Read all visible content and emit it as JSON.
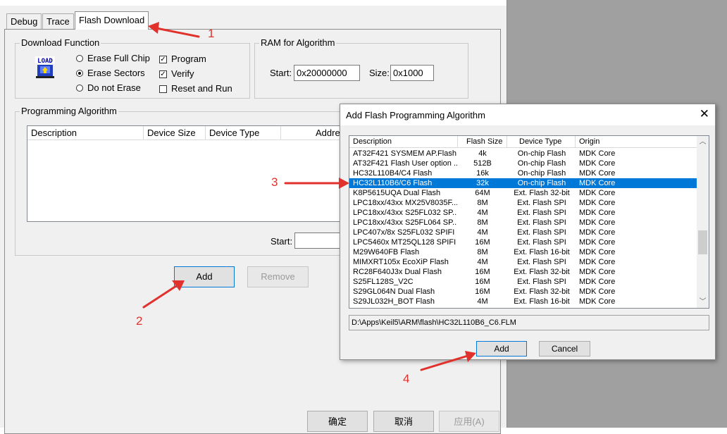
{
  "tabs": [
    {
      "label": "Debug"
    },
    {
      "label": "Trace"
    },
    {
      "label": "Flash Download"
    }
  ],
  "download_function": {
    "title": "Download Function",
    "icon": "load-icon",
    "icon_text": "LOAD",
    "radios": [
      {
        "label": "Erase Full Chip",
        "selected": false
      },
      {
        "label": "Erase Sectors",
        "selected": true
      },
      {
        "label": "Do not Erase",
        "selected": false
      }
    ],
    "checks": [
      {
        "label": "Program",
        "checked": true
      },
      {
        "label": "Verify",
        "checked": true
      },
      {
        "label": "Reset and Run",
        "checked": false
      }
    ]
  },
  "ram_algorithm": {
    "title": "RAM for Algorithm",
    "start_label": "Start:",
    "start_value": "0x20000000",
    "size_label": "Size:",
    "size_value": "0x1000"
  },
  "programming_algorithm": {
    "title": "Programming Algorithm",
    "columns": [
      "Description",
      "Device Size",
      "Device Type",
      "Address Range"
    ],
    "start_label": "Start:",
    "add_button": "Add",
    "remove_button": "Remove"
  },
  "footer": {
    "ok": "确定",
    "cancel": "取消",
    "apply": "应用(A)"
  },
  "add_dialog": {
    "title": "Add Flash Programming Algorithm",
    "columns": [
      "Description",
      "Flash Size",
      "Device Type",
      "Origin"
    ],
    "rows": [
      {
        "description": "AT32F421 SYSMEM AP.Flash",
        "size": "4k",
        "type": "On-chip Flash",
        "origin": "MDK Core",
        "selected": false
      },
      {
        "description": "AT32F421 Flash User option ...",
        "size": "512B",
        "type": "On-chip Flash",
        "origin": "MDK Core",
        "selected": false
      },
      {
        "description": "HC32L110B4/C4 Flash",
        "size": "16k",
        "type": "On-chip Flash",
        "origin": "MDK Core",
        "selected": false
      },
      {
        "description": "HC32L110B6/C6 Flash",
        "size": "32k",
        "type": "On-chip Flash",
        "origin": "MDK Core",
        "selected": true
      },
      {
        "description": "K8P5615UQA Dual Flash",
        "size": "64M",
        "type": "Ext. Flash 32-bit",
        "origin": "MDK Core",
        "selected": false
      },
      {
        "description": "LPC18xx/43xx MX25V8035F...",
        "size": "8M",
        "type": "Ext. Flash SPI",
        "origin": "MDK Core",
        "selected": false
      },
      {
        "description": "LPC18xx/43xx S25FL032 SP...",
        "size": "4M",
        "type": "Ext. Flash SPI",
        "origin": "MDK Core",
        "selected": false
      },
      {
        "description": "LPC18xx/43xx S25FL064 SP...",
        "size": "8M",
        "type": "Ext. Flash SPI",
        "origin": "MDK Core",
        "selected": false
      },
      {
        "description": "LPC407x/8x S25FL032 SPIFI",
        "size": "4M",
        "type": "Ext. Flash SPI",
        "origin": "MDK Core",
        "selected": false
      },
      {
        "description": "LPC5460x MT25QL128 SPIFI",
        "size": "16M",
        "type": "Ext. Flash SPI",
        "origin": "MDK Core",
        "selected": false
      },
      {
        "description": "M29W640FB Flash",
        "size": "8M",
        "type": "Ext. Flash 16-bit",
        "origin": "MDK Core",
        "selected": false
      },
      {
        "description": "MIMXRT105x EcoXiP Flash",
        "size": "4M",
        "type": "Ext. Flash SPI",
        "origin": "MDK Core",
        "selected": false
      },
      {
        "description": "RC28F640J3x Dual Flash",
        "size": "16M",
        "type": "Ext. Flash 32-bit",
        "origin": "MDK Core",
        "selected": false
      },
      {
        "description": "S25FL128S_V2C",
        "size": "16M",
        "type": "Ext. Flash SPI",
        "origin": "MDK Core",
        "selected": false
      },
      {
        "description": "S29GL064N Dual Flash",
        "size": "16M",
        "type": "Ext. Flash 32-bit",
        "origin": "MDK Core",
        "selected": false
      },
      {
        "description": "S29JL032H_BOT Flash",
        "size": "4M",
        "type": "Ext. Flash 16-bit",
        "origin": "MDK Core",
        "selected": false
      }
    ],
    "path": "D:\\Apps\\Keil5\\ARM\\flash\\HC32L110B6_C6.FLM",
    "add_button": "Add",
    "cancel_button": "Cancel",
    "close_glyph": "✕"
  },
  "annotations": [
    "1",
    "2",
    "3",
    "4"
  ],
  "colors": {
    "arrow": "#e0312c",
    "selection": "#0078d7"
  }
}
